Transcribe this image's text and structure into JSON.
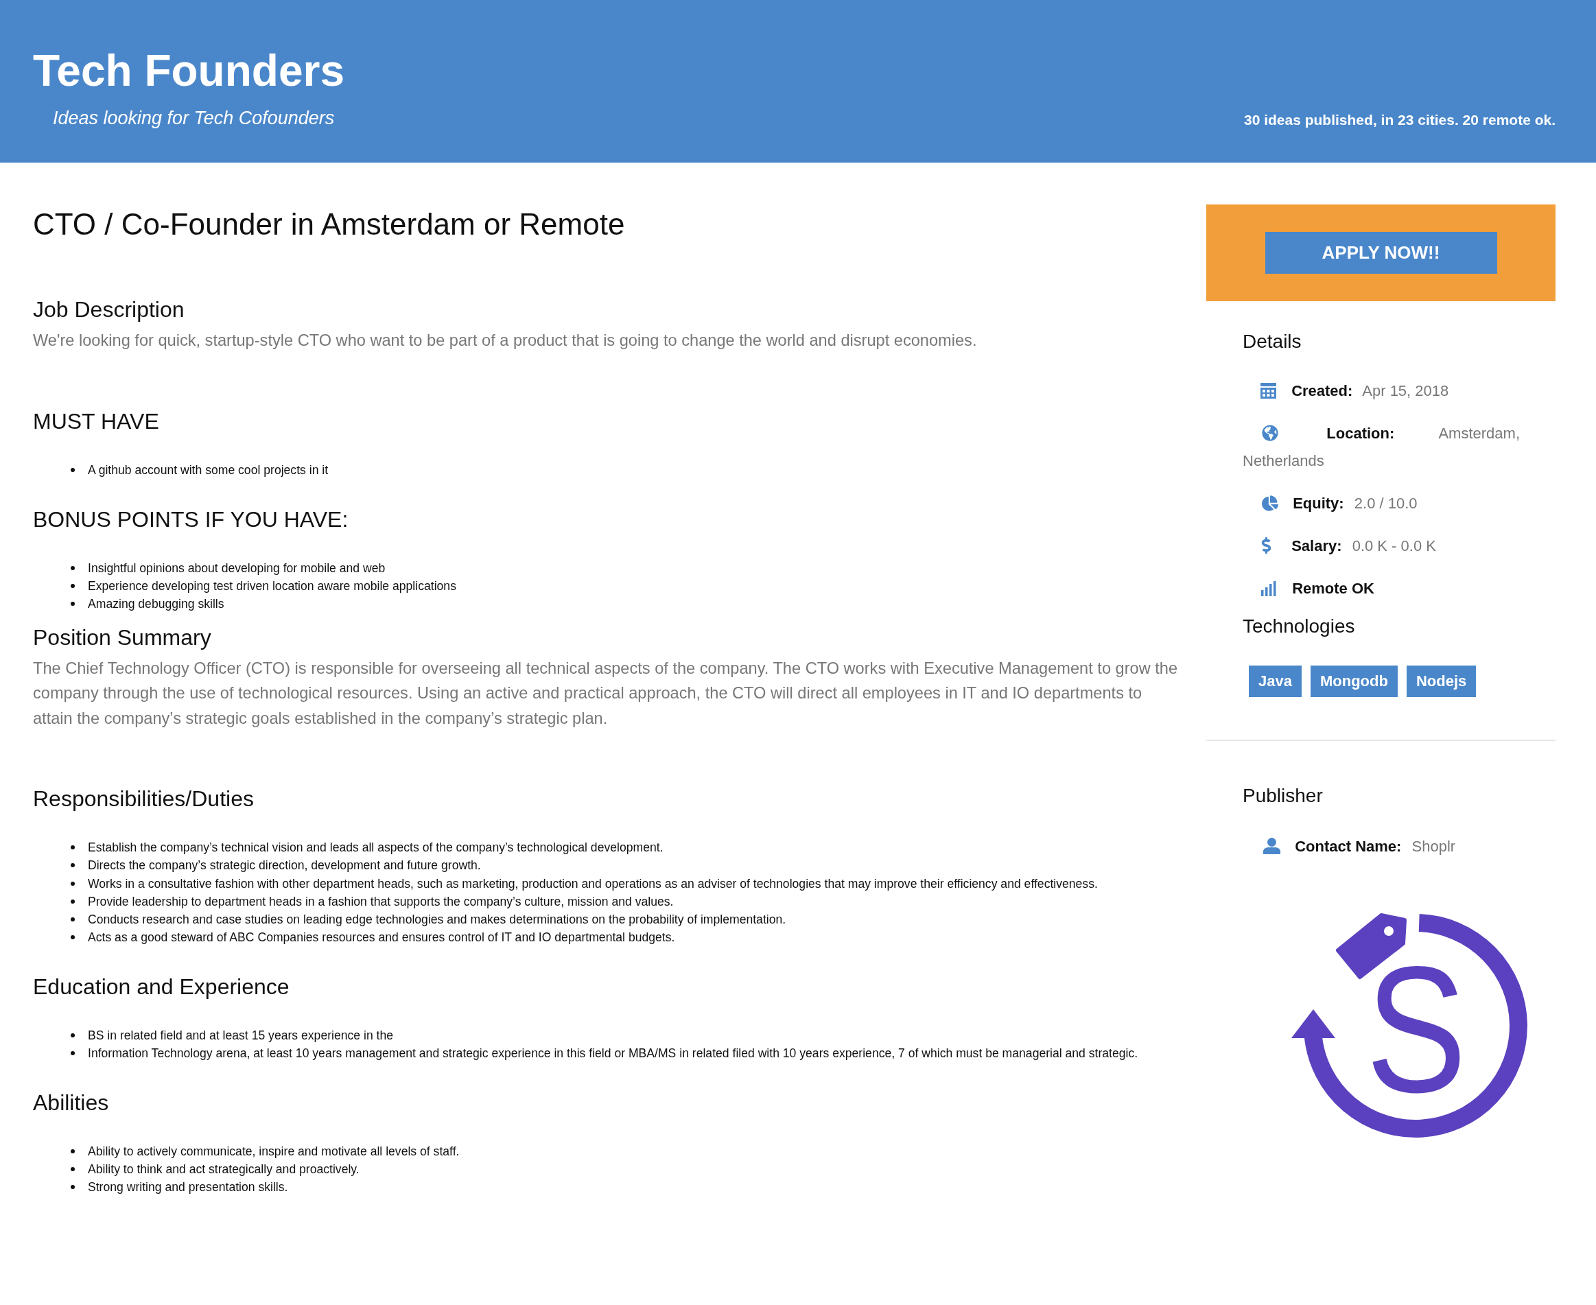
{
  "header": {
    "title": "Tech Founders",
    "tagline": "Ideas looking for Tech Cofounders",
    "stats": "30 ideas published, in 23 cities. 20 remote ok."
  },
  "job": {
    "title": "CTO / Co-Founder in Amsterdam or Remote",
    "sections": [
      {
        "kind": "paragraph",
        "heading": "Job Description",
        "text": "We're looking for quick, startup-style CTO who want to be part of a product that is going to change the world and disrupt economies."
      },
      {
        "kind": "bullets",
        "heading": "MUST HAVE",
        "items": [
          "A github account with some cool projects in it"
        ]
      },
      {
        "kind": "bullets",
        "heading": "BONUS POINTS IF YOU HAVE:",
        "items": [
          "Insightful opinions about developing for mobile and web",
          "Experience developing test driven location aware mobile applications",
          "Amazing debugging skills"
        ]
      },
      {
        "kind": "paragraph",
        "heading": "Position Summary",
        "text": "The Chief Technology Officer (CTO) is responsible for overseeing all technical aspects of the company. The CTO works with Executive Management to grow the company through the use of technological resources. Using an active and practical approach, the CTO will direct all employees in IT and IO departments to attain the company’s strategic goals established in the company’s strategic plan."
      },
      {
        "kind": "bullets",
        "heading": "Responsibilities/Duties",
        "items": [
          "Establish the company’s technical vision and leads all aspects of the company’s technological development.",
          "Directs the company’s strategic direction, development and future growth.",
          "Works in a consultative fashion with other department heads, such as marketing, production and operations as an adviser of technologies that may improve their efficiency and effectiveness.",
          "Provide leadership to department heads in a fashion that supports the company’s culture, mission and values.",
          "Conducts research and case studies on leading edge technologies and makes determinations on the probability of implementation.",
          "Acts as a good steward of ABC Companies resources and ensures control of IT and IO departmental budgets."
        ]
      },
      {
        "kind": "bullets",
        "heading": "Education and Experience",
        "items": [
          "BS in related field and at least 15 years experience in the",
          "Information Technology arena, at least 10 years management and strategic experience in this field or MBA/MS in related filed with 10 years experience, 7 of which must be managerial and strategic."
        ]
      },
      {
        "kind": "bullets",
        "heading": "Abilities",
        "items": [
          "Ability to actively communicate, inspire and motivate all levels of staff.",
          "Ability to think and act strategically and proactively.",
          "Strong writing and presentation skills."
        ]
      }
    ]
  },
  "sidebar": {
    "apply_button": "APPLY NOW!!",
    "details": {
      "heading": "Details",
      "rows": [
        {
          "kind": "created",
          "label": "Created:",
          "value": [
            "Apr 15, 2018"
          ]
        },
        {
          "kind": "location",
          "label": "Location:",
          "value": [
            "Amsterdam,",
            "Netherlands"
          ]
        },
        {
          "kind": "equity",
          "label": "Equity:",
          "value": [
            "2.0 / 10.0"
          ]
        },
        {
          "kind": "salary",
          "label": "Salary:",
          "value": [
            "0.0 K - 0.0 K"
          ]
        },
        {
          "kind": "remote",
          "label": "Remote OK"
        }
      ]
    },
    "technologies": {
      "heading": "Technologies",
      "tags": [
        "Java",
        "Mongodb",
        "Nodejs"
      ]
    },
    "publisher": {
      "heading": "Publisher",
      "rows": [
        {
          "kind": "contact",
          "label": "Contact Name:",
          "value": [
            "Shoplr"
          ]
        }
      ],
      "logo": {
        "letter": "S"
      }
    }
  }
}
